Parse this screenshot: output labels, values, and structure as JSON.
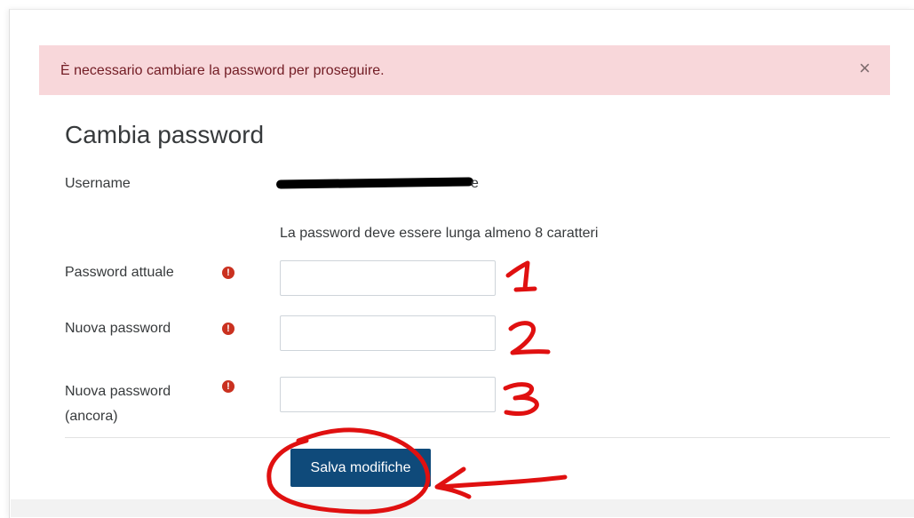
{
  "alert": {
    "message": "È necessario cambiare la password per proseguire.",
    "close_glyph": "×"
  },
  "form": {
    "title": "Cambia password",
    "username_label": "Username",
    "username_value_visible_tail": "e",
    "password_rule": "La password deve essere lunga almeno 8 caratteri",
    "fields": [
      {
        "label": "Password attuale",
        "value": "",
        "required_icon": "exclamation-circle-icon"
      },
      {
        "label": "Nuova password",
        "value": "",
        "required_icon": "exclamation-circle-icon"
      },
      {
        "label_line1": "Nuova password",
        "label_line2": "(ancora)",
        "value": "",
        "required_icon": "exclamation-circle-icon"
      }
    ],
    "submit_label": "Salva modifiche"
  },
  "annotations": {
    "numbers": [
      "1",
      "2",
      "3"
    ],
    "ink_color": "#e01010"
  },
  "colors": {
    "alert_bg": "#f8d7da",
    "alert_text": "#721c24",
    "primary_button": "#0f4a7a",
    "required_icon": "#ca3120"
  }
}
